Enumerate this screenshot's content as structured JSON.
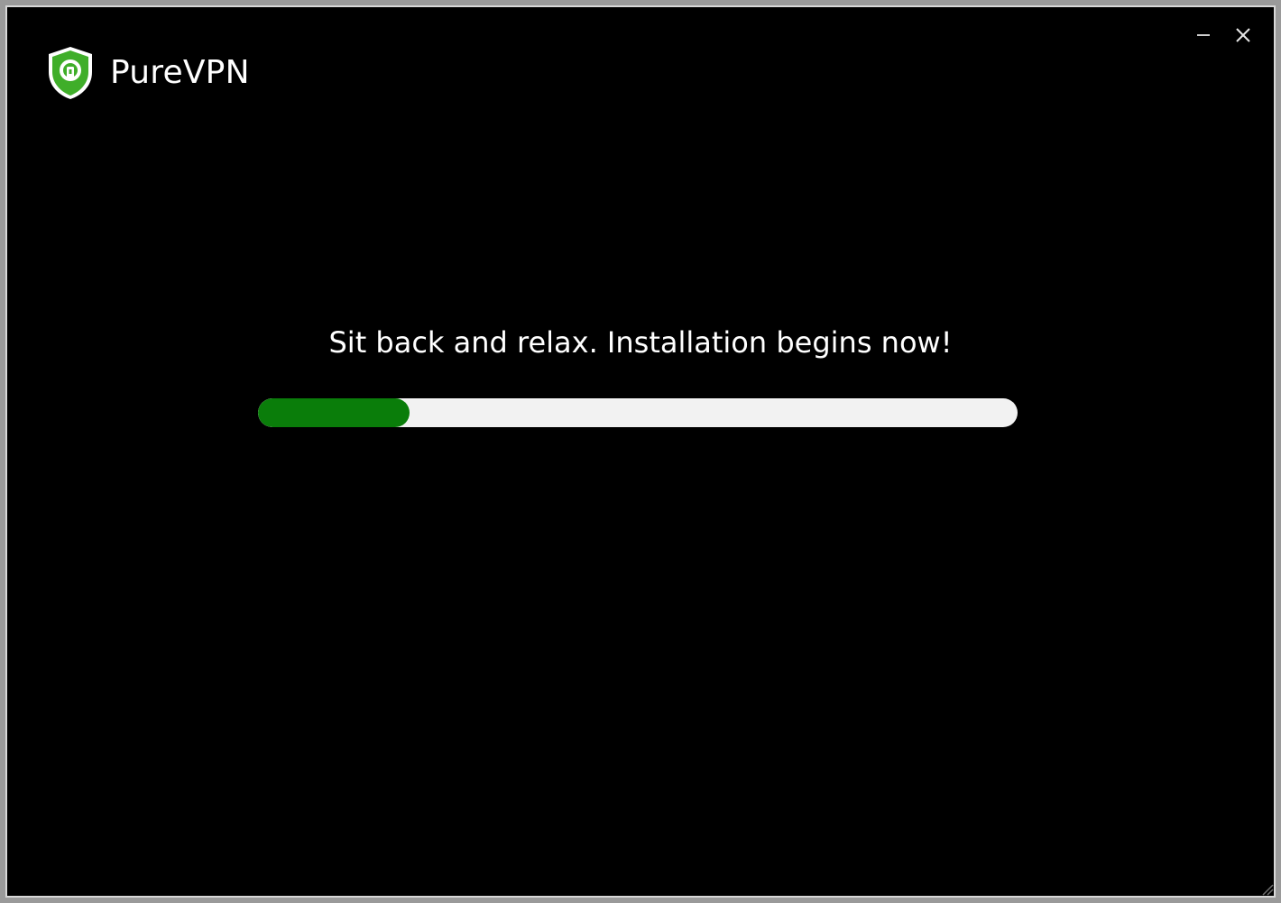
{
  "app": {
    "name": "PureVPN",
    "logo_icon": "purevpn-shield-icon",
    "brand_color": "#3fae29"
  },
  "window_controls": {
    "minimize_icon": "minimize-icon",
    "close_icon": "close-icon"
  },
  "installer": {
    "message": "Sit back and relax. Installation begins now!",
    "progress": 0.2,
    "progress_color": "#0a7d0a",
    "track_color": "#f2f2f2"
  }
}
